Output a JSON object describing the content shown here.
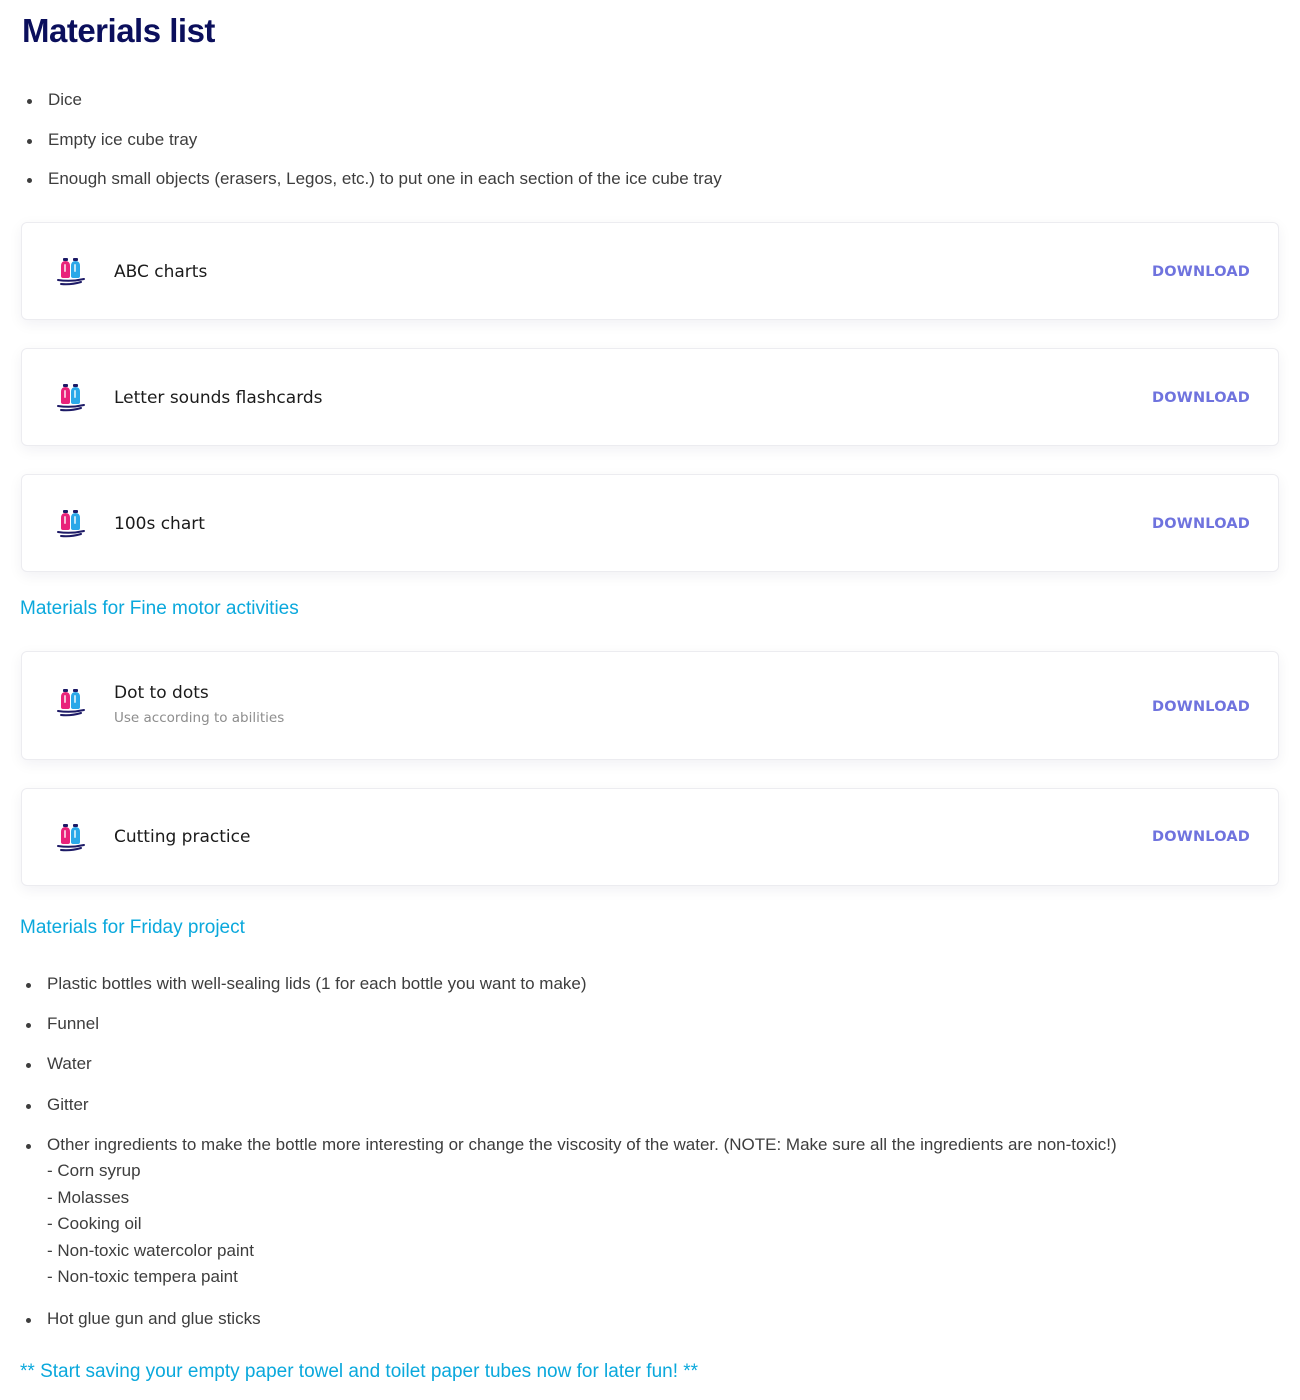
{
  "page_title": "Materials list",
  "materials_list": [
    "Dice",
    "Empty ice cube tray",
    "Enough small objects (erasers, Legos, etc.) to put one in each section of the ice cube tray"
  ],
  "download_cards_1": [
    {
      "title": "ABC charts",
      "action": "DOWNLOAD"
    },
    {
      "title": "Letter sounds flashcards",
      "action": "DOWNLOAD"
    },
    {
      "title": "100s chart",
      "action": "DOWNLOAD"
    }
  ],
  "fine_motor": {
    "heading": "Materials for Fine motor activities",
    "cards": [
      {
        "title": "Dot to dots",
        "subtitle": "Use according to abilities",
        "action": "DOWNLOAD"
      },
      {
        "title": "Cutting practice",
        "action": "DOWNLOAD"
      }
    ]
  },
  "friday_project": {
    "heading": "Materials for Friday project",
    "items": [
      "Plastic bottles with well-sealing lids (1 for each bottle you want to make)",
      "Funnel",
      "Water",
      "Gitter",
      "Other ingredients to make the bottle more interesting or change the viscosity of the water. (NOTE: Make sure all the ingredients are non-toxic!)",
      "Hot glue gun and glue sticks"
    ],
    "sub_items": [
      "- Corn syrup",
      "- Molasses",
      "- Cooking oil",
      "- Non-toxic watercolor paint",
      "- Non-toxic tempera paint"
    ]
  },
  "footer_note": "** Start saving your empty paper towel and toilet paper tubes now for later fun! **",
  "icon_name": "bottles-icon",
  "colors": {
    "title": "#0b0f5c",
    "accent_heading": "#0aa8dc",
    "download": "#6f73de",
    "bottle_pink": "#e8227a",
    "bottle_blue": "#2aa8e8",
    "bottle_navy": "#1d1a66"
  }
}
